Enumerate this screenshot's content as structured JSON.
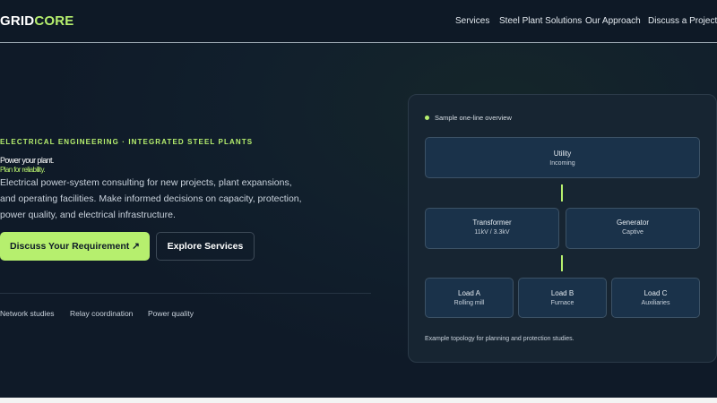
{
  "header": {
    "logo_part1": "GRID",
    "logo_part2": "CORE",
    "nav": [
      "Services",
      "Steel Plant Solutions",
      "Our Approach",
      "Discuss a Project ↗"
    ]
  },
  "hero": {
    "eyebrow": "ELECTRICAL ENGINEERING · INTEGRATED STEEL PLANTS",
    "headline_line1": "Power your plant.",
    "headline_line2": "Plan for reliability.",
    "description": "Electrical power-system consulting for new projects, plant expansions, and operating facilities. Make informed decisions on capacity, protection, power quality, and electrical infrastructure.",
    "primary_button": "Discuss Your Requirement ↗",
    "secondary_button": "Explore Services",
    "features": [
      "Network studies",
      "Relay coordination",
      "Power quality"
    ]
  },
  "diagram": {
    "label": "Sample one-line overview",
    "utility": {
      "title": "Utility",
      "sub": "Incoming"
    },
    "transformer": {
      "title": "Transformer",
      "sub": "11kV / 3.3kV"
    },
    "generator": {
      "title": "Generator",
      "sub": "Captive"
    },
    "loads": [
      {
        "title": "Load A",
        "sub": "Rolling mill"
      },
      {
        "title": "Load B",
        "sub": "Furnace"
      },
      {
        "title": "Load C",
        "sub": "Auxiliaries"
      }
    ],
    "note": "Example topology for planning and protection studies."
  },
  "colors": {
    "accent": "#b6ef6e",
    "background": "#111f2c",
    "node_fill": "#1a324a"
  }
}
